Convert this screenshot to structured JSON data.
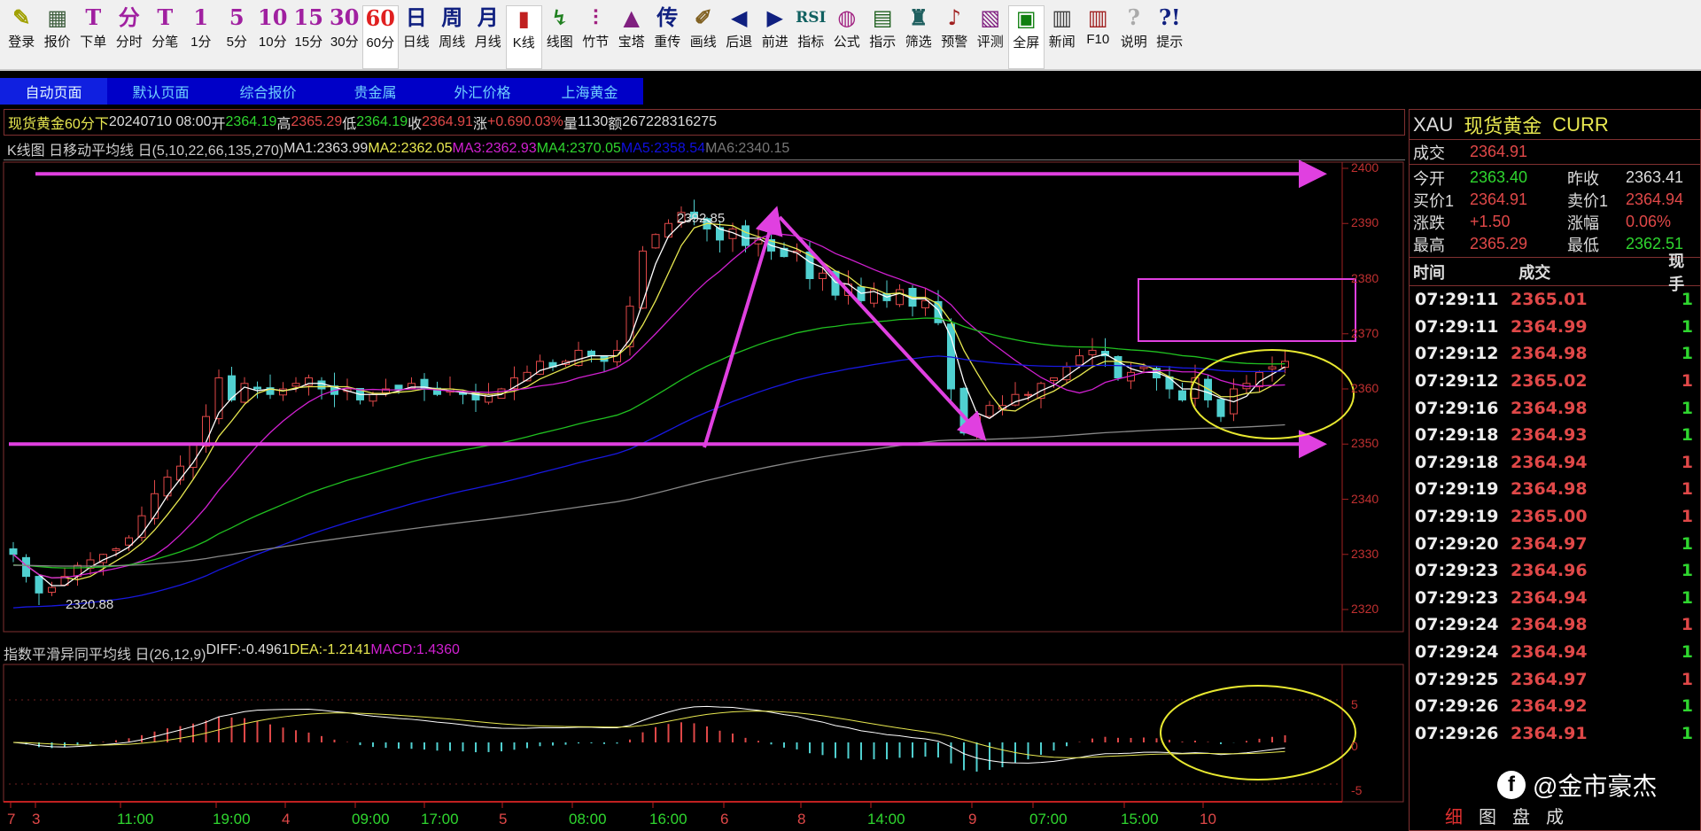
{
  "toolbar": [
    {
      "icon": "✎",
      "label": "登录",
      "name": "login",
      "color": "#a0a000"
    },
    {
      "icon": "▦",
      "label": "报价",
      "name": "quote",
      "color": "#406040"
    },
    {
      "icon": "T",
      "label": "下单",
      "name": "order",
      "color": "#a020a0"
    },
    {
      "icon": "分",
      "label": "分时",
      "name": "intraday",
      "color": "#a020a0"
    },
    {
      "icon": "T",
      "label": "分笔",
      "name": "tick",
      "color": "#a020a0"
    },
    {
      "icon": "1",
      "label": "1分",
      "name": "1min",
      "color": "#a020a0"
    },
    {
      "icon": "5",
      "label": "5分",
      "name": "5min",
      "color": "#a020a0"
    },
    {
      "icon": "10",
      "label": "10分",
      "name": "10min",
      "color": "#a020a0"
    },
    {
      "icon": "15",
      "label": "15分",
      "name": "15min",
      "color": "#a020a0"
    },
    {
      "icon": "30",
      "label": "30分",
      "name": "30min",
      "color": "#a020a0"
    },
    {
      "icon": "60",
      "label": "60分",
      "name": "60min",
      "color": "#e02020",
      "selected": true
    },
    {
      "icon": "日",
      "label": "日线",
      "name": "daily",
      "color": "#102080"
    },
    {
      "icon": "周",
      "label": "周线",
      "name": "weekly",
      "color": "#102080"
    },
    {
      "icon": "月",
      "label": "月线",
      "name": "monthly",
      "color": "#102080"
    },
    {
      "icon": "▮",
      "label": "K线",
      "name": "kline",
      "color": "#c02020",
      "selected": true
    },
    {
      "icon": "↯",
      "label": "线图",
      "name": "linechart",
      "color": "#208020"
    },
    {
      "icon": "⫶",
      "label": "竹节",
      "name": "bamboo",
      "color": "#a02080"
    },
    {
      "icon": "▲",
      "label": "宝塔",
      "name": "tower",
      "color": "#802080"
    },
    {
      "icon": "传",
      "label": "重传",
      "name": "resend",
      "color": "#102080"
    },
    {
      "icon": "✐",
      "label": "画线",
      "name": "draw",
      "color": "#806020"
    },
    {
      "icon": "◀",
      "label": "后退",
      "name": "back",
      "color": "#102080"
    },
    {
      "icon": "▶",
      "label": "前进",
      "name": "forward",
      "color": "#102080"
    },
    {
      "icon": "RSI",
      "label": "指标",
      "name": "indicator",
      "color": "#106060"
    },
    {
      "icon": "◍",
      "label": "公式",
      "name": "formula",
      "color": "#a02080"
    },
    {
      "icon": "▤",
      "label": "指示",
      "name": "hint",
      "color": "#206020"
    },
    {
      "icon": "♜",
      "label": "筛选",
      "name": "filter",
      "color": "#206060"
    },
    {
      "icon": "♪",
      "label": "预警",
      "name": "alert",
      "color": "#a02020"
    },
    {
      "icon": "▧",
      "label": "评测",
      "name": "evaluate",
      "color": "#802080"
    },
    {
      "icon": "▣",
      "label": "全屏",
      "name": "fullscreen",
      "color": "#108010",
      "selected": true
    },
    {
      "icon": "▥",
      "label": "新闻",
      "name": "news",
      "color": "#404040"
    },
    {
      "icon": "▥",
      "label": "F10",
      "name": "f10",
      "color": "#a02020"
    },
    {
      "icon": "?",
      "label": "说明",
      "name": "help",
      "color": "#aaaaaa"
    },
    {
      "icon": "?!",
      "label": "提示",
      "name": "tips",
      "color": "#102080"
    }
  ],
  "tabs": [
    "自动页面",
    "默认页面",
    "综合报价",
    "贵金属",
    "外汇价格",
    "上海黄金"
  ],
  "info": {
    "name": "现货黄金",
    "period": "60分",
    "dir": "下",
    "datetime": "20240710 08:00",
    "open_l": "开",
    "open": "2364.19",
    "high_l": "高",
    "high": "2365.29",
    "low_l": "低",
    "low": "2364.19",
    "close_l": "收",
    "close": "2364.91",
    "chg_l": "涨",
    "chg": "+0.69",
    "pct": "0.03%",
    "vol_l": "量",
    "vol": "1130",
    "amt_l": "额",
    "amt": "2672283",
    "extra": "16275"
  },
  "ma": {
    "title": "K线图 日移动平均线 日(5,10,22,66,135,270)",
    "ma1": "MA1:2363.99",
    "ma2": "MA2:2362.05",
    "ma3": "MA3:2362.93",
    "ma4": "MA4:2370.05",
    "ma5": "MA5:2358.54",
    "ma6": "MA6:2340.15"
  },
  "macd": {
    "title": "指数平滑异同平均线 日(26,12,9)",
    "diff": "DIFF:-0.4961",
    "dea": "DEA:-1.2141",
    "macd": "MACD:1.4360",
    "yticks": [
      "5",
      "0",
      "-5"
    ]
  },
  "annotations": {
    "high": "2392.85",
    "low": "2320.88"
  },
  "colors": {
    "up": "#e04848",
    "down": "#50d0d0",
    "ma1": "#ffffff",
    "ma2": "#e8e850",
    "ma3": "#d020d0",
    "ma4": "#20c020",
    "ma5": "#1818e0",
    "ma6": "#888888",
    "annotation": "#e040e0",
    "circle": "#e8e830"
  },
  "chart_data": {
    "type": "candlestick",
    "ylim": [
      2315,
      2402
    ],
    "yticks": [
      2400,
      2390,
      2380,
      2370,
      2360,
      2350,
      2340,
      2330,
      2320
    ],
    "closes": [
      2330,
      2326,
      2323,
      2324,
      2326,
      2328,
      2329,
      2330,
      2331,
      2333,
      2337,
      2341,
      2344,
      2346,
      2350,
      2355,
      2362,
      2358,
      2361,
      2360,
      2359,
      2360,
      2361,
      2362,
      2360,
      2359,
      2360,
      2358,
      2359,
      2360,
      2360,
      2361,
      2360,
      2359,
      2360,
      2359,
      2358,
      2359,
      2360,
      2362,
      2363,
      2365,
      2364,
      2365,
      2367,
      2366,
      2365,
      2367,
      2375,
      2385,
      2388,
      2390,
      2392,
      2391,
      2389,
      2387,
      2389,
      2386,
      2387,
      2385,
      2384,
      2385,
      2380,
      2381,
      2377,
      2379,
      2376,
      2378,
      2376,
      2378,
      2375,
      2376,
      2372,
      2360,
      2352,
      2355,
      2357,
      2357,
      2359,
      2359,
      2361,
      2362,
      2364,
      2366,
      2367,
      2366,
      2362,
      2363,
      2364,
      2362,
      2360,
      2358,
      2362,
      2358,
      2355,
      2360,
      2361,
      2363,
      2364,
      2365
    ],
    "xlabels": [
      {
        "t": "7",
        "day": true
      },
      {
        "t": "3",
        "day": true
      },
      {
        "t": "11:00"
      },
      {
        "t": "19:00"
      },
      {
        "t": "4",
        "day": true
      },
      {
        "t": "09:00"
      },
      {
        "t": "17:00"
      },
      {
        "t": "5",
        "day": true
      },
      {
        "t": "08:00"
      },
      {
        "t": "16:00"
      },
      {
        "t": "6",
        "day": true
      },
      {
        "t": "8",
        "day": true
      },
      {
        "t": "14:00"
      },
      {
        "t": "9",
        "day": true
      },
      {
        "t": "07:00"
      },
      {
        "t": "15:00"
      },
      {
        "t": "10",
        "day": true
      }
    ]
  },
  "right": {
    "code": "XAU",
    "name": "现货黄金",
    "type": "CURR",
    "last_l": "成交",
    "last": "2364.91",
    "rows": [
      {
        "a": "今开",
        "av": "2363.40",
        "ac": "g",
        "b": "昨收",
        "bv": "2363.41",
        "bc": "w"
      },
      {
        "a": "买价1",
        "av": "2364.91",
        "ac": "r",
        "b": "卖价1",
        "bv": "2364.94",
        "bc": "r"
      },
      {
        "a": "涨跌",
        "av": "+1.50",
        "ac": "r",
        "b": "涨幅",
        "bv": "0.06%",
        "bc": "r"
      },
      {
        "a": "最高",
        "av": "2365.29",
        "ac": "r",
        "b": "最低",
        "bv": "2362.51",
        "bc": "g"
      }
    ],
    "cols": [
      "时间",
      "成交",
      "现手"
    ],
    "ticks": [
      [
        "07:29:11",
        "2365.01",
        "1",
        "g"
      ],
      [
        "07:29:11",
        "2364.99",
        "1",
        "g"
      ],
      [
        "07:29:12",
        "2364.98",
        "1",
        "g"
      ],
      [
        "07:29:12",
        "2365.02",
        "1",
        "r"
      ],
      [
        "07:29:16",
        "2364.98",
        "1",
        "g"
      ],
      [
        "07:29:18",
        "2364.93",
        "1",
        "g"
      ],
      [
        "07:29:18",
        "2364.94",
        "1",
        "r"
      ],
      [
        "07:29:19",
        "2364.98",
        "1",
        "r"
      ],
      [
        "07:29:19",
        "2365.00",
        "1",
        "r"
      ],
      [
        "07:29:20",
        "2364.97",
        "1",
        "g"
      ],
      [
        "07:29:23",
        "2364.96",
        "1",
        "g"
      ],
      [
        "07:29:23",
        "2364.94",
        "1",
        "g"
      ],
      [
        "07:29:24",
        "2364.98",
        "1",
        "r"
      ],
      [
        "07:29:24",
        "2364.94",
        "1",
        "g"
      ],
      [
        "07:29:25",
        "2364.97",
        "1",
        "r"
      ],
      [
        "07:29:26",
        "2364.92",
        "1",
        "g"
      ],
      [
        "07:29:26",
        "2364.91",
        "1",
        "g"
      ]
    ],
    "tabs": [
      "细",
      "图",
      "盘",
      "成"
    ]
  },
  "watermark": "@金市豪杰"
}
